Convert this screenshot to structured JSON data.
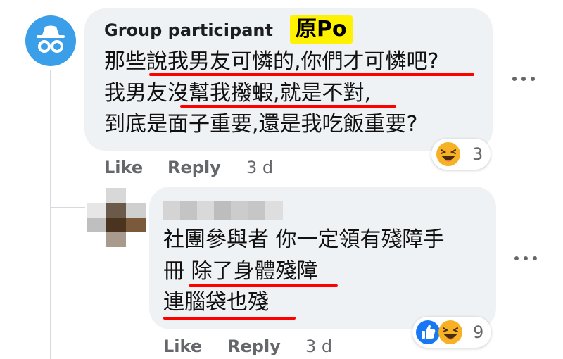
{
  "comment1": {
    "author": "Group participant",
    "badge": "原Po",
    "lines": [
      "那些說我男友可憐的,你們才可憐吧?",
      "我男友沒幫我撥蝦,就是不對,",
      "到底是面子重要,還是我吃飯重要?"
    ],
    "actions": {
      "like": "Like",
      "reply": "Reply",
      "time": "3 d"
    },
    "reaction_count": "3",
    "reaction_icons": [
      "laugh-emoji"
    ]
  },
  "reply1": {
    "author_hidden": true,
    "lines": [
      "社團參與者 你一定領有殘障手",
      "冊 除了身體殘障",
      "連腦袋也殘"
    ],
    "actions": {
      "like": "Like",
      "reply": "Reply",
      "time": "3 d"
    },
    "reaction_count": "9",
    "reaction_icons": [
      "like-thumb",
      "laugh-emoji"
    ]
  },
  "colors": {
    "bubble": "#eff2f5",
    "avatar_anon": "#3a9ee8",
    "badge_yellow": "#fff200",
    "underline_red": "#ff0000",
    "meta_gray": "#65676b"
  }
}
